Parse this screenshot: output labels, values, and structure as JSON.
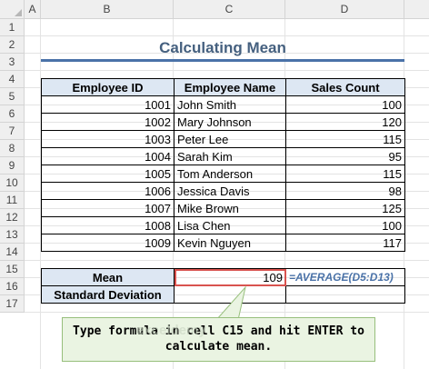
{
  "columns": [
    "A",
    "B",
    "C",
    "D"
  ],
  "rows": [
    "1",
    "2",
    "3",
    "4",
    "5",
    "6",
    "7",
    "8",
    "9",
    "10",
    "11",
    "12",
    "13",
    "14",
    "15",
    "16",
    "17"
  ],
  "title": "Calculating Mean",
  "table": {
    "headers": [
      "Employee ID",
      "Employee Name",
      "Sales Count"
    ],
    "rows": [
      [
        "1001",
        "John Smith",
        "100"
      ],
      [
        "1002",
        "Mary Johnson",
        "120"
      ],
      [
        "1003",
        "Peter Lee",
        "115"
      ],
      [
        "1004",
        "Sarah Kim",
        "95"
      ],
      [
        "1005",
        "Tom Anderson",
        "115"
      ],
      [
        "1006",
        "Jessica Davis",
        "98"
      ],
      [
        "1007",
        "Mike Brown",
        "125"
      ],
      [
        "1008",
        "Lisa Chen",
        "100"
      ],
      [
        "1009",
        "Kevin Nguyen",
        "117"
      ]
    ]
  },
  "stats": {
    "mean_label": "Mean",
    "mean_value": "109",
    "mean_formula": "=AVERAGE(D5:D13)",
    "std_label": "Standard Deviation",
    "std_value": ""
  },
  "callout": {
    "line1": "Type formula in cell C15 and hit ENTER to",
    "line2": "calculate mean."
  },
  "watermark": "exceldemy",
  "colors": {
    "header_fill": "#dde7f3",
    "title": "#45607f",
    "accent": "#4a72a8",
    "selection": "#d9534f",
    "callout_fill": "#eaf4e2"
  }
}
